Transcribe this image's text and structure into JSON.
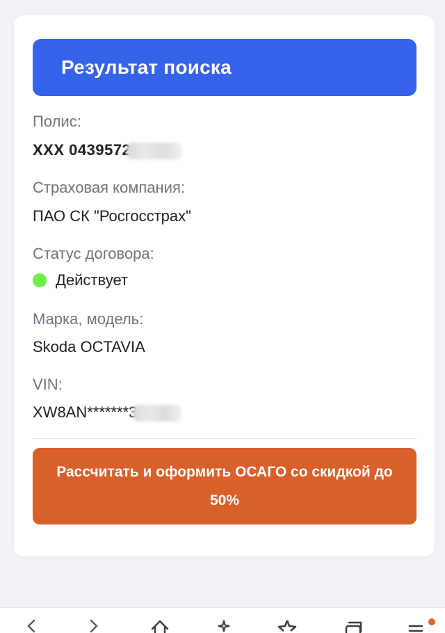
{
  "result_card": {
    "title": "Результат поиска",
    "policy": {
      "label": "Полис:",
      "value": "XXX 0439572"
    },
    "insurer": {
      "label": "Страховая компания:",
      "value": "ПАО СК \"Росгосстрах\""
    },
    "status": {
      "label": "Статус договора:",
      "value": "Действует",
      "color": "#6df04a"
    },
    "vehicle": {
      "label": "Марка, модель:",
      "value": "Skoda OCTAVIA"
    },
    "vin": {
      "label": "VIN:",
      "value": "XW8AN*******3"
    },
    "cta_label": "Рассчитать и оформить ОСАГО со скидкой до 50%"
  },
  "colors": {
    "header_blue": "#3563e9",
    "cta_orange": "#d9602a",
    "page_bg": "#f1f2f6"
  },
  "bottom_nav": {
    "icons": [
      "back-arrow-icon",
      "forward-arrow-icon",
      "home-icon",
      "sparkle-icon",
      "star-icon",
      "tabs-icon",
      "menu-icon"
    ]
  }
}
